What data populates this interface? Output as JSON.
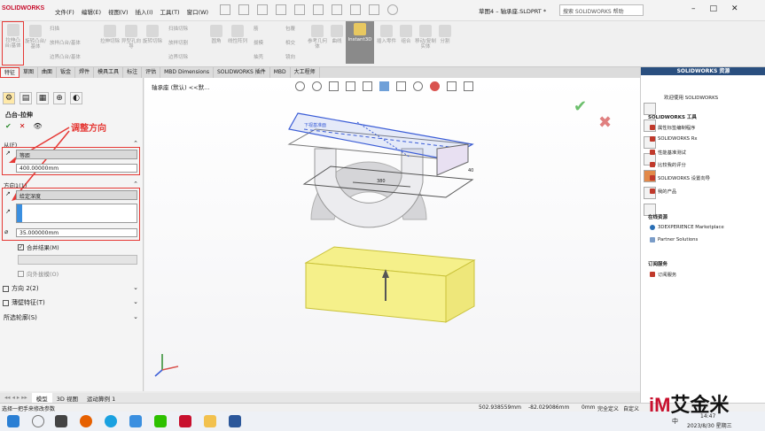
{
  "app": {
    "brand": "SOLIDWORKS",
    "doc_title": "草图4 – 轴承座.SLDPRT *"
  },
  "menu": [
    "文件(F)",
    "编辑(E)",
    "视图(V)",
    "插入(I)",
    "工具(T)",
    "窗口(W)"
  ],
  "search": {
    "placeholder": "搜索 SOLIDWORKS 帮助"
  },
  "ribbon": {
    "extrude": "拉伸凸台/基体",
    "revolve": "旋转凸台/基体",
    "sweep": "扫描",
    "loft": "放样凸台/基体",
    "boundary": "边界凸台/基体",
    "cut_extrude": "拉伸切除",
    "hole_wizard": "异型孔向导",
    "cut_revolve": "旋转切除",
    "swept_cut": "扫描切除",
    "lofted_cut": "放样切割",
    "boundary_cut": "边界切除",
    "fillet": "圆角",
    "linear_pattern": "线性阵列",
    "rib": "筋",
    "draft": "拔模",
    "shell": "抽壳",
    "wrap": "包覆",
    "intersect": "相交",
    "mirror": "镜向",
    "ref_geom": "参考几何体",
    "curves": "曲线",
    "instant3d": "Instant3D",
    "insert_part": "插入零件",
    "combine": "组合",
    "move_copy": "移动/复制实体",
    "split": "分割"
  },
  "tabs": [
    "特征",
    "草图",
    "曲面",
    "钣金",
    "焊件",
    "模具工具",
    "标注",
    "评估",
    "MBD Dimensions",
    "SOLIDWORKS 插件",
    "MBD",
    "大工程师"
  ],
  "feature_tree": {
    "item": "轴承座 (默认) <<默..."
  },
  "property_manager": {
    "title": "凸台-拉伸",
    "annotation": "调整方向",
    "from_label": "从(F)",
    "from_value": "等距",
    "from_offset": "400.00000mm",
    "dir1_label": "方向1(1)",
    "end_condition": "给定深度",
    "depth": "35.000000mm",
    "merge_label": "合并结果(M)",
    "draft_label": "向外拔模(O)",
    "dir2_label": "方向 2(2)",
    "thin_label": "薄壁特征(T)",
    "contours_label": "所选轮廓(S)"
  },
  "viewport": {
    "dim_a": "380",
    "dim_b": "40",
    "sketch_label": "下视基准面"
  },
  "task_pane": {
    "header": "SOLIDWORKS 资源",
    "welcome": "欢迎使用 SOLIDWORKS",
    "tools_h": "SOLIDWORKS 工具",
    "tools": [
      "属性标签编制程序",
      "SOLIDWORKS Rx",
      "性能基准测试",
      "比较我的评分",
      "SOLIDWORKS 设置向导",
      "我的产品"
    ],
    "online_h": "在线资源",
    "online": [
      "3DEXPERIENCE Marketplace",
      "Partner Solutions"
    ],
    "sub_h": "订阅服务",
    "sub": [
      "订阅服务"
    ]
  },
  "bottom_tabs": [
    "模型",
    "3D 视图",
    "运动算例 1"
  ],
  "status": {
    "hint": "选择一把手来修改参数",
    "x": "502.938559mm",
    "y": "-82.029086mm",
    "z": "0mm",
    "state": "完全定义",
    "units": "自定义"
  },
  "taskbar": {
    "time": "14:47",
    "date": "2023/8/30 星期三",
    "ime": "中"
  },
  "watermark": {
    "im": "iM",
    "name": "艾金米"
  },
  "colors": {
    "accent_red": "#e53935",
    "header_blue": "#2a4f7f",
    "preview_yellow": "#f5f08a"
  }
}
